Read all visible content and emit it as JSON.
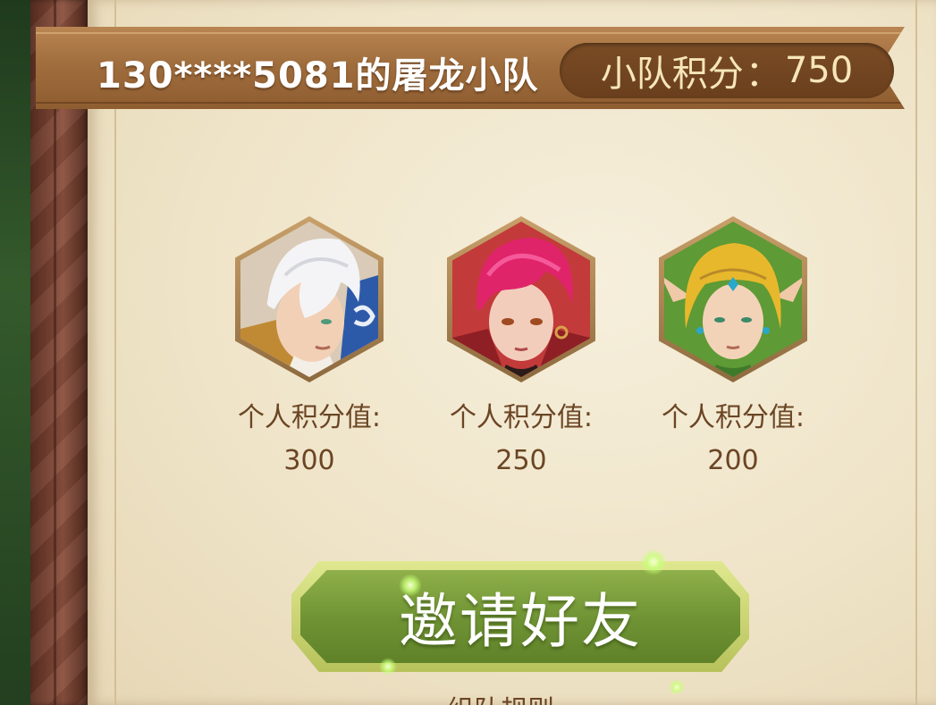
{
  "header": {
    "team_title": "130****5081的屠龙小队",
    "score_label": "小队积分",
    "score_separator": "：",
    "score_value": "750"
  },
  "members": [
    {
      "label": "个人积分值:",
      "score": "300",
      "avatar_icon": "white-haired-hero-avatar"
    },
    {
      "label": "个人积分值:",
      "score": "250",
      "avatar_icon": "pink-haired-heroine-avatar"
    },
    {
      "label": "个人积分值:",
      "score": "200",
      "avatar_icon": "blonde-elf-avatar"
    }
  ],
  "invite_button": {
    "label": "邀请好友"
  },
  "footer": {
    "rules_link": "组队规则"
  },
  "colors": {
    "ribbon": "#a06d3d",
    "score_pill": "#6a3f1d",
    "text_brown": "#6b4524",
    "button_green": "#6e9233",
    "parchment": "#efe4c8"
  }
}
